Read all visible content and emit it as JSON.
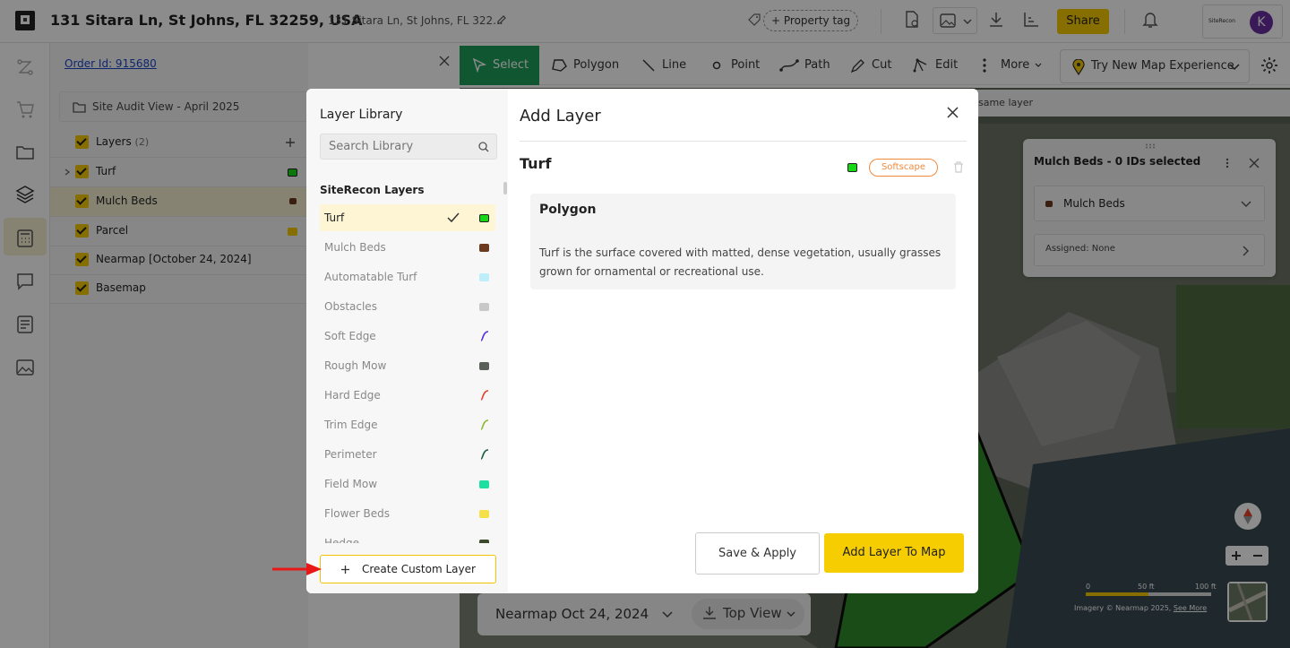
{
  "header": {
    "title": "131 Sitara Ln, St Johns, FL 32259, USA",
    "subtitle": "131 Sitara Ln, St Johns, FL 322...",
    "property_tag": "+ Property tag",
    "share": "Share",
    "account_logo": "SiteRecon",
    "avatar_initial": "K"
  },
  "panel": {
    "order_link": "Order Id: 915680",
    "site_view": "Site Audit View - April 2025",
    "layers_header": "Layers",
    "layers_count": "(2)",
    "rows": [
      {
        "name": "Turf",
        "color": "#16d916"
      },
      {
        "name": "Mulch Beds",
        "color": "#6b3a1f"
      },
      {
        "name": "Parcel",
        "color": "#f5c800"
      },
      {
        "name": "Nearmap",
        "date": "[October 24, 2024]"
      },
      {
        "name": "Basemap"
      }
    ]
  },
  "toolbar": {
    "select": "Select",
    "polygon": "Polygon",
    "line": "Line",
    "point": "Point",
    "path": "Path",
    "cut": "Cut",
    "edit": "Edit",
    "more": "More",
    "new_experience": "Try New Map Experience"
  },
  "map": {
    "info_text": "same layer",
    "card_title": "Mulch Beds - 0 IDs selected",
    "card_layer": "Mulch Beds",
    "card_assigned": "Assigned: None",
    "nearmap_date": "Nearmap Oct 24, 2024",
    "view_mode": "Top View",
    "scale_labels": [
      "0",
      "50 ft",
      "100 ft"
    ],
    "imagery_credit": "Imagery © Nearmap 2025,",
    "see_more": "See More"
  },
  "modal": {
    "library_title": "Layer Library",
    "search_placeholder": "Search Library",
    "section_title": "SiteRecon Layers",
    "library_items": [
      {
        "name": "Turf",
        "color": "#16d916",
        "selected": true
      },
      {
        "name": "Mulch Beds",
        "color": "#6b3a1f"
      },
      {
        "name": "Automatable Turf",
        "color": "#bdeefa"
      },
      {
        "name": "Obstacles",
        "color": "#c8c8c8"
      },
      {
        "name": "Soft Edge",
        "color": "#5a2de0",
        "line": true
      },
      {
        "name": "Rough Mow",
        "color": "#5a5f5a"
      },
      {
        "name": "Hard Edge",
        "color": "#e8402a",
        "line": true
      },
      {
        "name": "Trim Edge",
        "color": "#8bb82a",
        "line": true
      },
      {
        "name": "Perimeter",
        "color": "#1a5a3a",
        "line": true
      },
      {
        "name": "Field Mow",
        "color": "#1de0a0"
      },
      {
        "name": "Flower Beds",
        "color": "#f5e04a"
      },
      {
        "name": "Hedge",
        "color": "#3a4a2a"
      }
    ],
    "create_custom": "Create Custom Layer",
    "add_title": "Add Layer",
    "layer_name": "Turf",
    "layer_category": "Softscape",
    "layer_type": "Polygon",
    "layer_description": "Turf is the surface covered with matted, dense vegetation, usually grasses grown for ornamental or recreational use.",
    "save_apply": "Save & Apply",
    "add_to_map": "Add Layer To Map"
  }
}
